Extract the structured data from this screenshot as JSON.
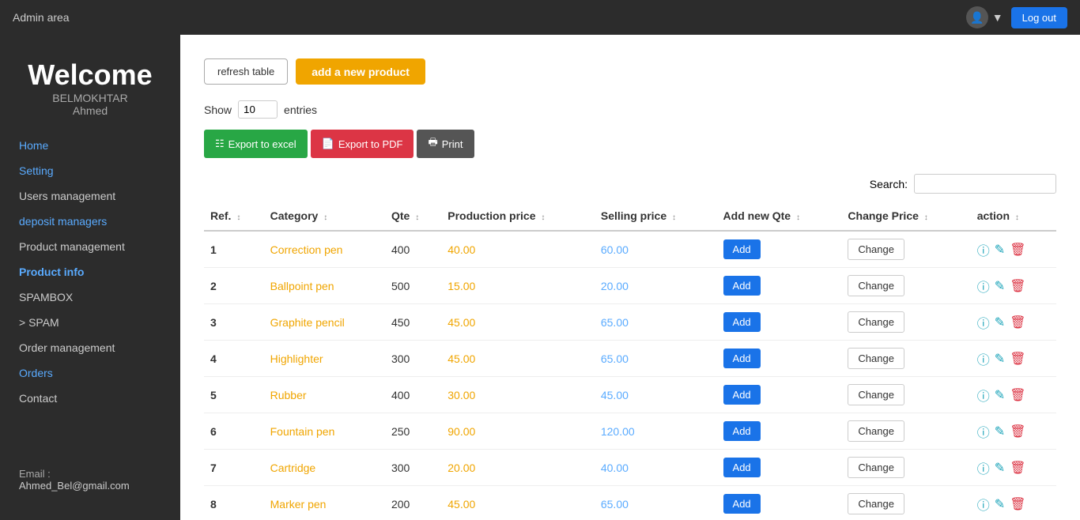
{
  "topbar": {
    "title": "Admin area",
    "logout_label": "Log out"
  },
  "sidebar": {
    "welcome": "Welcome",
    "name_line1": "BELMOKHTAR",
    "name_line2": "Ahmed",
    "nav_items": [
      {
        "label": "Home",
        "href": "#",
        "style": "link"
      },
      {
        "label": "Setting",
        "href": "#",
        "style": "link"
      },
      {
        "label": "Users management",
        "href": "#",
        "style": "plain"
      },
      {
        "label": "deposit managers",
        "href": "#",
        "style": "link"
      },
      {
        "label": "Product management",
        "href": "#",
        "style": "plain"
      },
      {
        "label": "Product info",
        "href": "#",
        "style": "link-active"
      },
      {
        "label": "SPAMBOX",
        "href": "#",
        "style": "plain"
      },
      {
        "label": "> SPAM",
        "href": "#",
        "style": "plain"
      },
      {
        "label": "Order management",
        "href": "#",
        "style": "plain"
      },
      {
        "label": "Orders",
        "href": "#",
        "style": "link"
      },
      {
        "label": "Contact",
        "href": "#",
        "style": "plain"
      }
    ],
    "email_label": "Email :",
    "email_value": "Ahmed_Bel@gmail.com"
  },
  "toolbar": {
    "refresh_label": "refresh table",
    "add_product_label": "add a new product"
  },
  "show_entries": {
    "show_label": "Show",
    "entries_label": "entries",
    "value": "10"
  },
  "export": {
    "excel_label": "Export to excel",
    "pdf_label": "Export to PDF",
    "print_label": "Print"
  },
  "search": {
    "label": "Search:",
    "placeholder": ""
  },
  "table": {
    "columns": [
      "Ref.",
      "Category",
      "Qte",
      "Production price",
      "Selling price",
      "Add new Qte",
      "Change Price",
      "action"
    ],
    "rows": [
      {
        "ref": "1",
        "category": "Correction pen",
        "qte": "400",
        "prod_price": "40.00",
        "sell_price": "60.00"
      },
      {
        "ref": "2",
        "category": "Ballpoint pen",
        "qte": "500",
        "prod_price": "15.00",
        "sell_price": "20.00"
      },
      {
        "ref": "3",
        "category": "Graphite pencil",
        "qte": "450",
        "prod_price": "45.00",
        "sell_price": "65.00"
      },
      {
        "ref": "4",
        "category": "Highlighter",
        "qte": "300",
        "prod_price": "45.00",
        "sell_price": "65.00"
      },
      {
        "ref": "5",
        "category": "Rubber",
        "qte": "400",
        "prod_price": "30.00",
        "sell_price": "45.00"
      },
      {
        "ref": "6",
        "category": "Fountain pen",
        "qte": "250",
        "prod_price": "90.00",
        "sell_price": "120.00"
      },
      {
        "ref": "7",
        "category": "Cartridge",
        "qte": "300",
        "prod_price": "20.00",
        "sell_price": "40.00"
      },
      {
        "ref": "8",
        "category": "Marker pen",
        "qte": "200",
        "prod_price": "45.00",
        "sell_price": "65.00"
      }
    ],
    "add_btn_label": "Add",
    "change_btn_label": "Change"
  }
}
